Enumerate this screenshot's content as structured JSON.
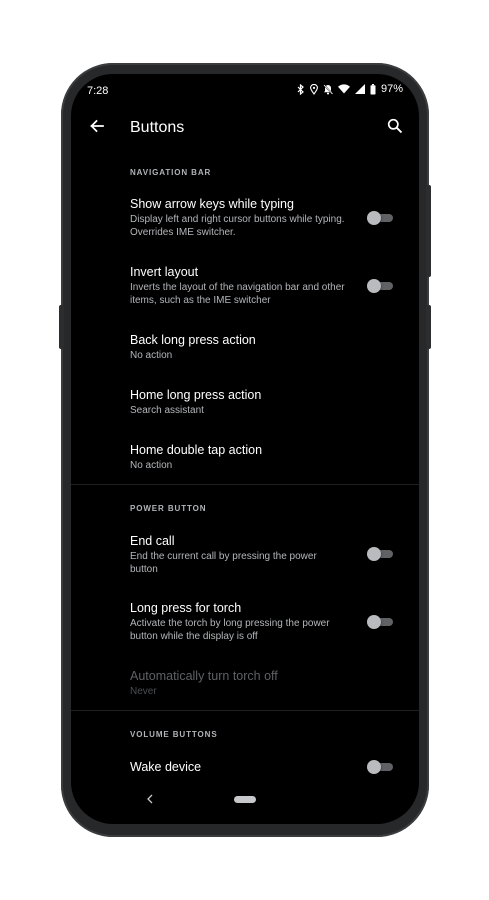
{
  "status_bar": {
    "time": "7:28",
    "battery": "97%",
    "icons": [
      "bluetooth-icon",
      "location-icon",
      "dnd-off-icon",
      "wifi-icon",
      "signal-icon",
      "battery-icon"
    ]
  },
  "app_bar": {
    "title": "Buttons",
    "icons": [
      "back-arrow-icon",
      "search-icon"
    ]
  },
  "sections": {
    "navigation_bar": {
      "header": "NAVIGATION BAR",
      "items": [
        {
          "title": "Show arrow keys while typing",
          "summary": "Display left and right cursor buttons while typing. Overrides IME switcher.",
          "toggle": false
        },
        {
          "title": "Invert layout",
          "summary": "Inverts the layout of the navigation bar and other items, such as the IME switcher",
          "toggle": false
        },
        {
          "title": "Back long press action",
          "summary": "No action"
        },
        {
          "title": "Home long press action",
          "summary": "Search assistant"
        },
        {
          "title": "Home double tap action",
          "summary": "No action"
        }
      ]
    },
    "power_button": {
      "header": "POWER BUTTON",
      "items": [
        {
          "title": "End call",
          "summary": "End the current call by pressing the power button",
          "toggle": false
        },
        {
          "title": "Long press for torch",
          "summary": "Activate the torch by long pressing the power button while the display is off",
          "toggle": false
        },
        {
          "title": "Automatically turn torch off",
          "summary": "Never",
          "enabled": false
        }
      ]
    },
    "volume_buttons": {
      "header": "VOLUME BUTTONS",
      "items": [
        {
          "title": "Wake device",
          "toggle": false
        }
      ]
    }
  },
  "colors": {
    "background": "#000000",
    "text_primary": "#ffffff",
    "text_secondary": "#b3b6ba",
    "toggle_off_thumb": "#b9bbbe",
    "toggle_off_track": "#5f6165"
  }
}
